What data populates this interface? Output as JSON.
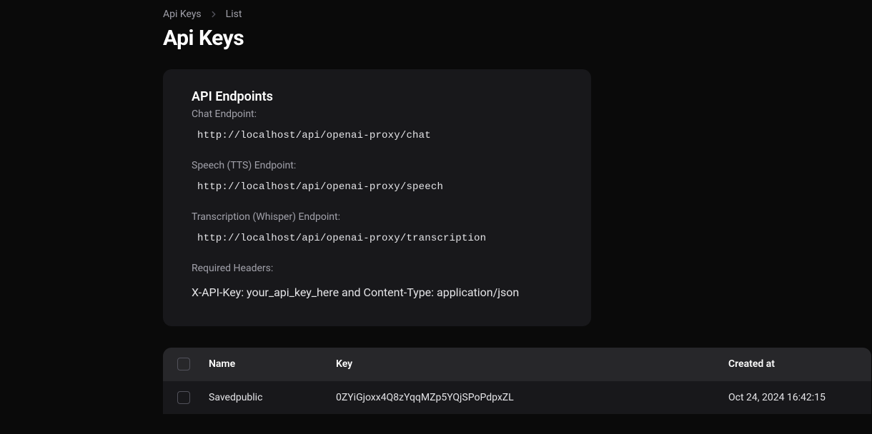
{
  "breadcrumb": {
    "items": [
      "Api Keys",
      "List"
    ]
  },
  "page": {
    "title": "Api Keys"
  },
  "card": {
    "title": "API Endpoints",
    "endpoints": [
      {
        "label": "Chat Endpoint:",
        "url": "http://localhost/api/openai-proxy/chat"
      },
      {
        "label": "Speech (TTS) Endpoint:",
        "url": "http://localhost/api/openai-proxy/speech"
      },
      {
        "label": "Transcription (Whisper) Endpoint:",
        "url": "http://localhost/api/openai-proxy/transcription"
      }
    ],
    "headers_label": "Required Headers:",
    "headers_text": "X-API-Key: your_api_key_here and Content-Type: application/json"
  },
  "table": {
    "columns": {
      "name": "Name",
      "key": "Key",
      "created_at": "Created at"
    },
    "rows": [
      {
        "name": "Savedpublic",
        "key": "0ZYiGjoxx4Q8zYqqMZp5YQjSPoPdpxZL",
        "created_at": "Oct 24, 2024 16:42:15"
      }
    ]
  }
}
